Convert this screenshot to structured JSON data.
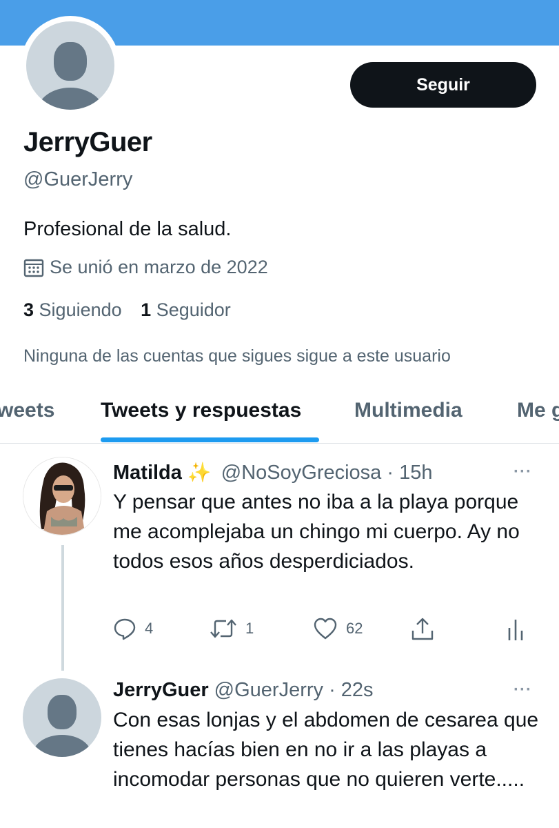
{
  "profile": {
    "display_name": "JerryGuer",
    "handle": "@GuerJerry",
    "bio": "Profesional de la salud.",
    "joined": "Se unió en marzo de 2022",
    "following_count": "3",
    "following_label": "Siguiendo",
    "followers_count": "1",
    "followers_label": "Seguidor",
    "not_followed_notice": "Ninguna de las cuentas que sigues sigue a este usuario",
    "follow_button": "Seguir"
  },
  "tabs": [
    {
      "label": "weets",
      "active": false
    },
    {
      "label": "Tweets y respuestas",
      "active": true
    },
    {
      "label": "Multimedia",
      "active": false
    },
    {
      "label": "Me g",
      "active": false
    }
  ],
  "tweets": [
    {
      "name": "Matilda",
      "emoji": "✨",
      "handle_time": "@NoSoyGreciosa · 15h",
      "text": "Y pensar que antes no iba a la playa porque me acomplejaba un chingo mi cuerpo. Ay no todos esos años desperdiciados.",
      "replies": "4",
      "retweets": "1",
      "likes": "62"
    },
    {
      "name": "JerryGuer",
      "handle_time": "@GuerJerry · 22s",
      "text": "Con esas lonjas y el abdomen de cesarea que tienes hacías bien en no ir a las playas a incomodar personas que no quieren verte....."
    }
  ],
  "more_glyph": "···",
  "colors": {
    "banner": "#4a9ee8",
    "accent": "#1d9bf0",
    "follow_button": "#0f1419",
    "secondary_text": "#536471"
  }
}
